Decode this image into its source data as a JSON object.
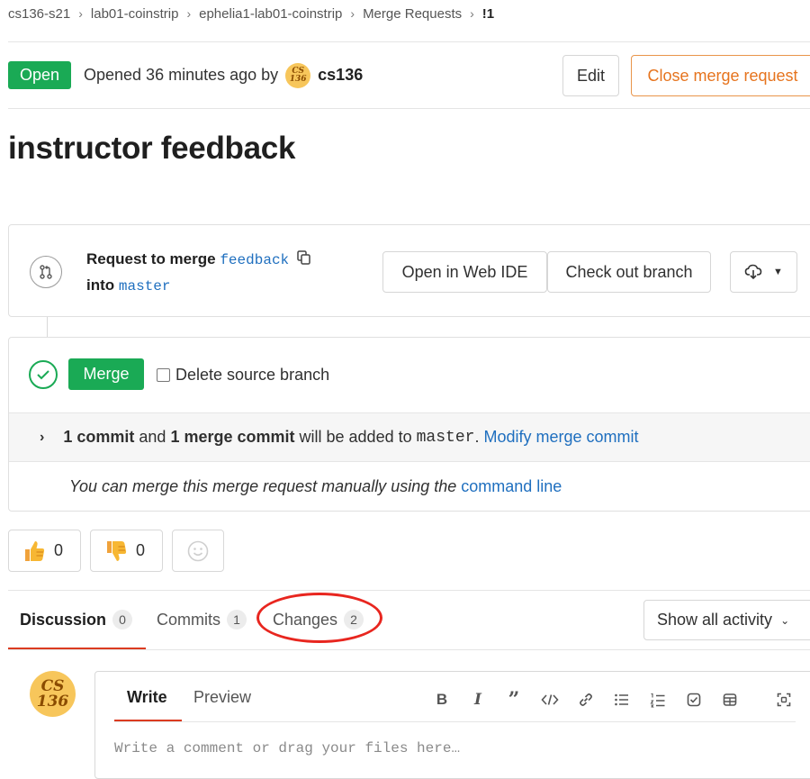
{
  "breadcrumb": [
    "cs136-s21",
    "lab01-coinstrip",
    "ephelia1-lab01-coinstrip",
    "Merge Requests",
    "!1"
  ],
  "header": {
    "status": "Open",
    "opened_text": "Opened 36 minutes ago by",
    "author": "cs136",
    "avatar_top": "CS",
    "avatar_bottom": "136",
    "edit_label": "Edit",
    "close_label": "Close merge request"
  },
  "title": "instructor feedback",
  "merge_info": {
    "request_prefix": "Request to merge",
    "source_branch": "feedback",
    "into_label": "into",
    "target_branch": "master",
    "open_web_ide": "Open in Web IDE",
    "check_out_branch": "Check out branch"
  },
  "merge_widget": {
    "merge_label": "Merge",
    "delete_source_label": "Delete source branch",
    "commit_count": "1 commit",
    "and_text": "and",
    "merge_commit_count": "1 merge commit",
    "will_be_added": "will be added to",
    "target_branch": "master",
    "period": ".",
    "modify_link": "Modify merge commit",
    "manual_text": "You can merge this merge request manually using the",
    "command_line_link": "command line"
  },
  "awards": {
    "thumbs_up_count": "0",
    "thumbs_down_count": "0"
  },
  "tabs": [
    {
      "label": "Discussion",
      "count": "0"
    },
    {
      "label": "Commits",
      "count": "1"
    },
    {
      "label": "Changes",
      "count": "2"
    }
  ],
  "activity_filter": "Show all activity",
  "comment": {
    "avatar_top": "CS",
    "avatar_bottom": "136",
    "write_tab": "Write",
    "preview_tab": "Preview",
    "placeholder": "Write a comment or drag your files here…"
  },
  "colors": {
    "success_green": "#1aaa55",
    "link_blue": "#1f6fbf",
    "close_orange": "#e6741e",
    "active_tab_red": "#db3b21",
    "annotation_red": "#e8261f"
  }
}
